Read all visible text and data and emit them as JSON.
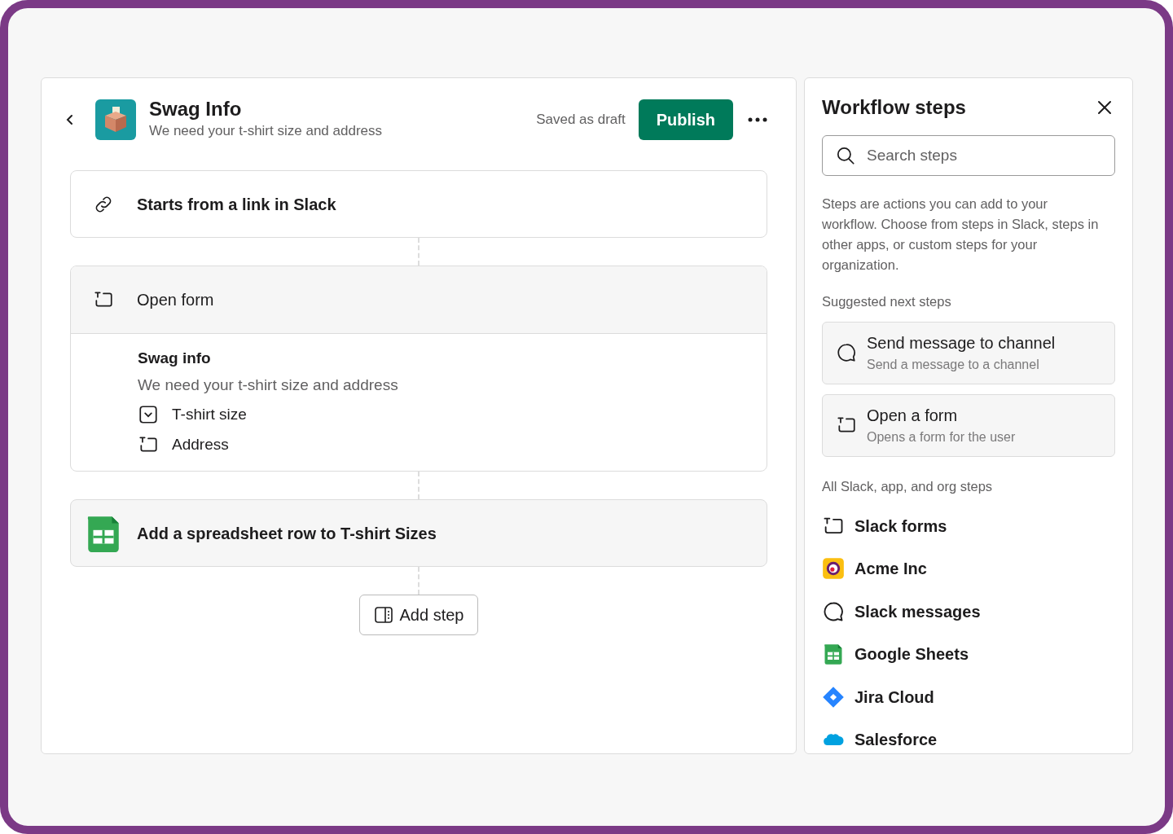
{
  "header": {
    "title": "Swag Info",
    "subtitle": "We need your t-shirt size and address",
    "status": "Saved as draft",
    "publish": "Publish"
  },
  "steps": [
    {
      "kind": "link",
      "title": "Starts from a link in Slack"
    },
    {
      "kind": "form",
      "title": "Open form",
      "form_title": "Swag info",
      "form_subtitle": "We need your t-shirt size and address",
      "fields": [
        {
          "kind": "dropdown",
          "label": "T-shirt size"
        },
        {
          "kind": "text",
          "label": "Address"
        }
      ]
    },
    {
      "kind": "sheets",
      "title": "Add a spreadsheet row to T-shirt Sizes"
    }
  ],
  "add_step": "Add step",
  "panel": {
    "title": "Workflow steps",
    "search": {
      "placeholder": "Search steps"
    },
    "description": "Steps are actions you can add to your workflow. Choose from steps in Slack, steps in other apps, or custom steps for your organization.",
    "suggested_heading": "Suggested next steps",
    "suggested": [
      {
        "kind": "chat",
        "title": "Send message to channel",
        "subtitle": "Send a message to a channel"
      },
      {
        "kind": "form",
        "title": "Open a form",
        "subtitle": "Opens a form for the user"
      }
    ],
    "all_heading": "All Slack, app, and org steps",
    "apps": [
      {
        "kind": "form",
        "label": "Slack forms"
      },
      {
        "kind": "acme",
        "label": "Acme Inc"
      },
      {
        "kind": "chat",
        "label": "Slack messages"
      },
      {
        "kind": "sheets",
        "label": "Google Sheets"
      },
      {
        "kind": "jira",
        "label": "Jira Cloud"
      },
      {
        "kind": "salesforce",
        "label": "Salesforce"
      }
    ]
  }
}
